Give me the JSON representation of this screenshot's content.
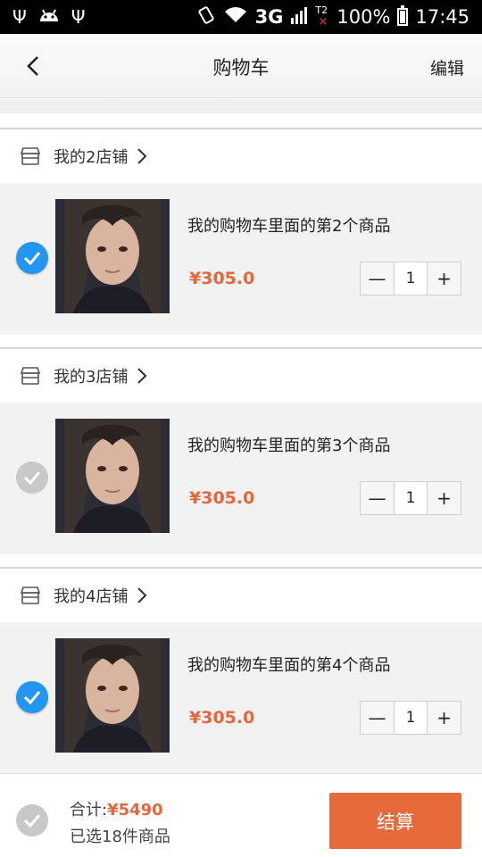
{
  "status_bar": {
    "network": "3G",
    "sim2": "T2",
    "battery": "100%",
    "time": "17:45"
  },
  "header": {
    "title": "购物车",
    "edit": "编辑"
  },
  "shops": [
    {
      "name": "我的2店铺",
      "item": {
        "name": "我的购物车里面的第2个商品",
        "price": "¥305.0",
        "quantity": "1",
        "checked": true
      }
    },
    {
      "name": "我的3店铺",
      "item": {
        "name": "我的购物车里面的第3个商品",
        "price": "¥305.0",
        "quantity": "1",
        "checked": false
      }
    },
    {
      "name": "我的4店铺",
      "item": {
        "name": "我的购物车里面的第4个商品",
        "price": "¥305.0",
        "quantity": "1",
        "checked": true
      }
    }
  ],
  "stepper": {
    "minus": "—",
    "plus": "+"
  },
  "footer": {
    "total_label": "合计:",
    "total_value": "¥5490",
    "selected_text": "已选18件商品",
    "checkout_label": "结算"
  },
  "colors": {
    "accent": "#e8663a",
    "check_on": "#2196f3",
    "check_off": "#c8c8c8"
  }
}
